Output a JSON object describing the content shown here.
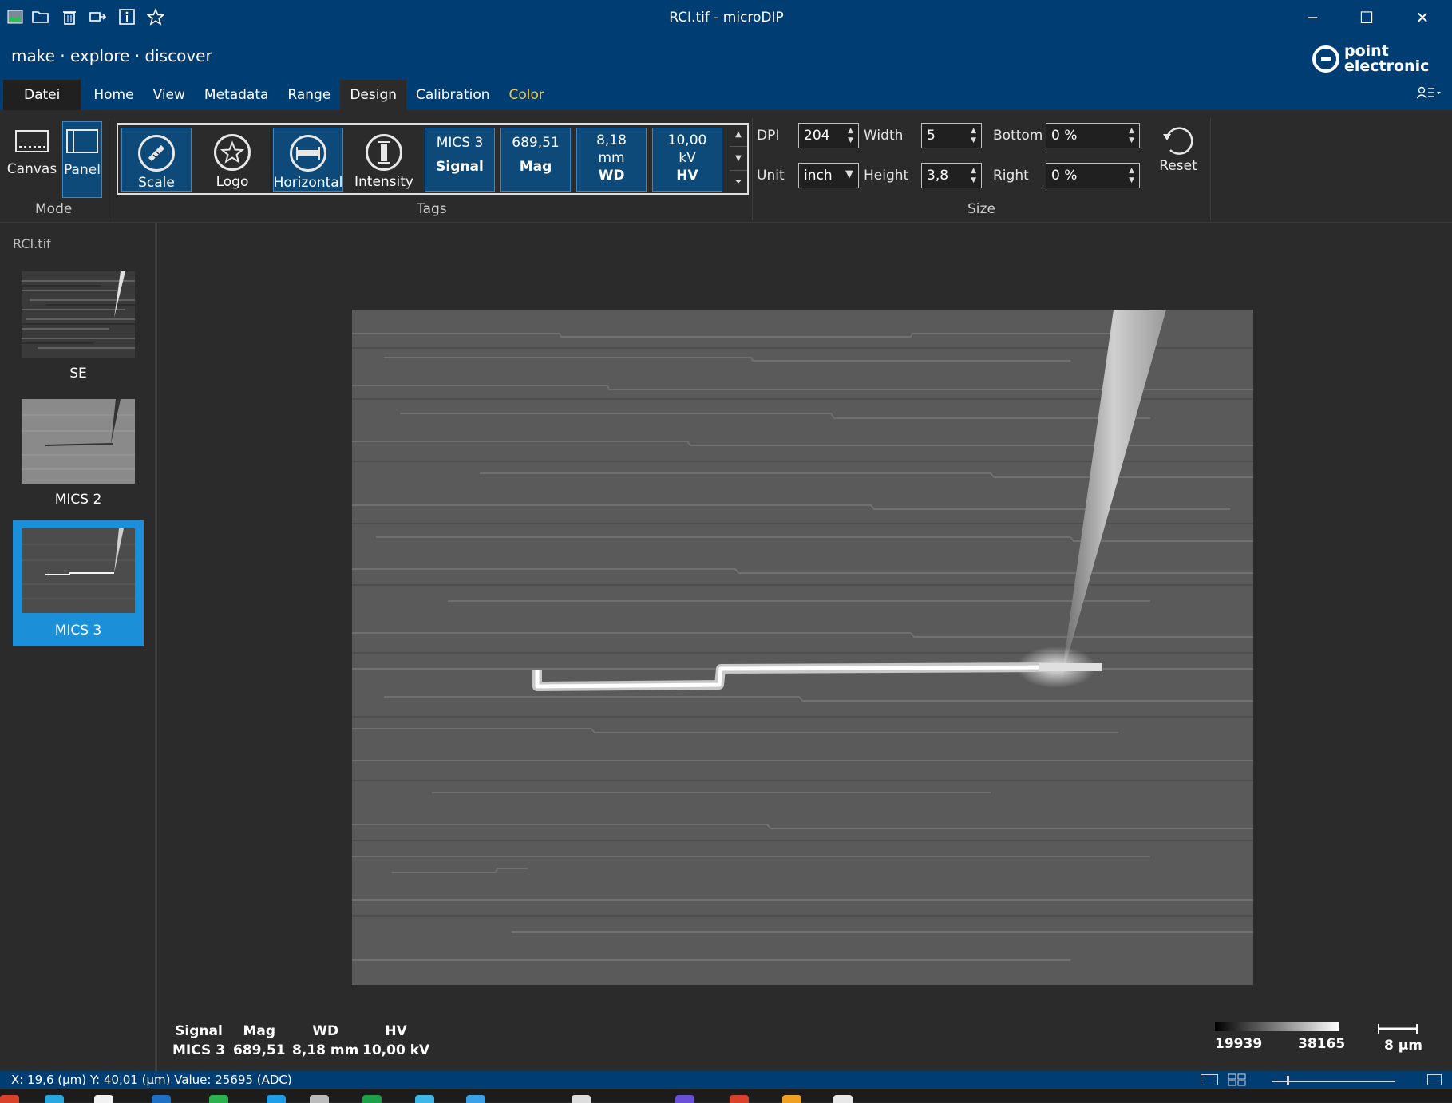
{
  "window": {
    "title": "RCI.tif - microDIP",
    "tagline": "make · explore · discover",
    "brand_line1": "point",
    "brand_line2": "electronic",
    "minimize_glyph": "─",
    "maximize_glyph": "☐",
    "close_glyph": "✕"
  },
  "menu": {
    "file": "Datei",
    "home": "Home",
    "view": "View",
    "metadata": "Metadata",
    "range": "Range",
    "design": "Design",
    "calibration": "Calibration",
    "color": "Color"
  },
  "mode": {
    "canvas": "Canvas",
    "panel": "Panel",
    "group_label": "Mode"
  },
  "tags": {
    "group_label": "Tags",
    "scale": "Scale",
    "logo": "Logo",
    "horizontal": "Horizontal",
    "intensity": "Intensity",
    "signal_value": "MICS 3",
    "signal_label": "Signal",
    "mag_value": "689,51",
    "mag_label": "Mag",
    "wd_value": "8,18",
    "wd_unit": "mm",
    "wd_label": "WD",
    "hv_value": "10,00",
    "hv_unit": "kV",
    "hv_label": "HV"
  },
  "size": {
    "group_label": "Size",
    "dpi_label": "DPI",
    "dpi_value": "204",
    "unit_label": "Unit",
    "unit_value": "inch",
    "width_label": "Width",
    "width_value": "5",
    "height_label": "Height",
    "height_value": "3,8",
    "bottom_label": "Bottom",
    "bottom_value": "0 %",
    "right_label": "Right",
    "right_value": "0 %",
    "reset": "Reset"
  },
  "sidebar": {
    "document": "RCI.tif",
    "items": [
      {
        "label": "SE"
      },
      {
        "label": "MICS 2"
      },
      {
        "label": "MICS 3"
      }
    ]
  },
  "info": {
    "signal_label": "Signal",
    "signal_value": "MICS 3",
    "mag_label": "Mag",
    "mag_value": "689,51",
    "wd_label": "WD",
    "wd_value": "8,18 mm",
    "hv_label": "HV",
    "hv_value": "10,00 kV",
    "range_min": "19939",
    "range_max": "38165",
    "scale_label": "8 µm"
  },
  "status": {
    "text": "X: 19,6 (µm)  Y: 40,01 (µm)  Value: 25695 (ADC)"
  },
  "colors": {
    "header": "#003d73",
    "selection": "#1b8fd8",
    "accent_menu": "#f5c542"
  }
}
